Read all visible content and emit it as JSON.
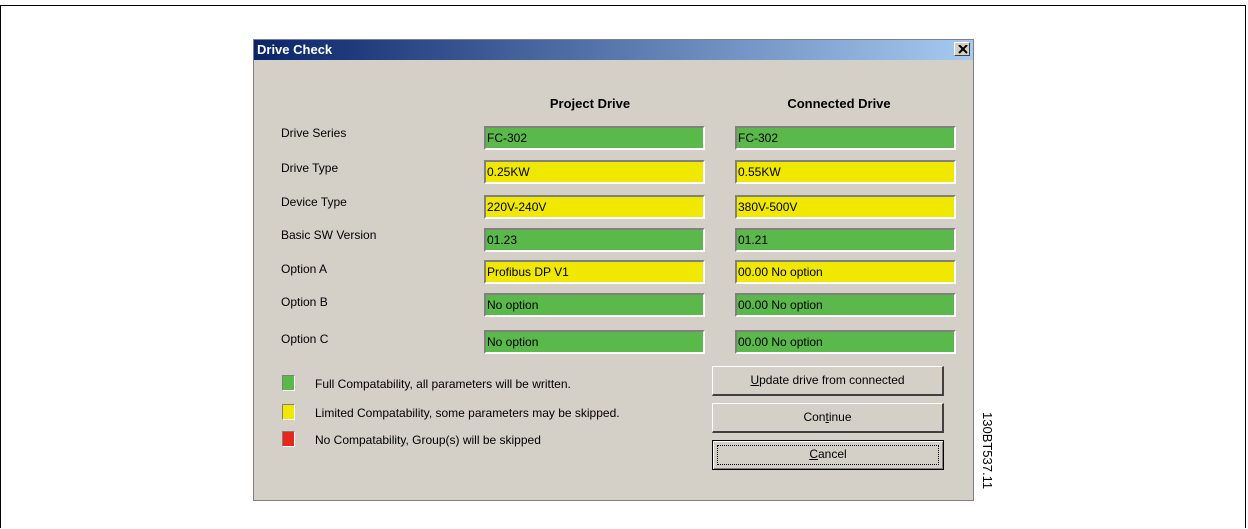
{
  "dialog": {
    "title": "Drive Check",
    "close_glyph": "✕"
  },
  "columns": {
    "project": "Project Drive",
    "connected": "Connected Drive"
  },
  "rows": [
    {
      "label": "Drive Series",
      "project": "FC-302",
      "connected": "FC-302",
      "project_status": "green",
      "connected_status": "green"
    },
    {
      "label": "Drive Type",
      "project": "0.25KW",
      "connected": "0.55KW",
      "project_status": "yellow",
      "connected_status": "yellow"
    },
    {
      "label": "Device Type",
      "project": "220V-240V",
      "connected": "380V-500V",
      "project_status": "yellow",
      "connected_status": "yellow"
    },
    {
      "label": "Basic SW Version",
      "project": "01.23",
      "connected": "01.21",
      "project_status": "green",
      "connected_status": "green"
    },
    {
      "label": "Option A",
      "project": "Profibus DP V1",
      "connected": "00.00 No option",
      "project_status": "yellow",
      "connected_status": "yellow"
    },
    {
      "label": "Option B",
      "project": "No option",
      "connected": "00.00 No option",
      "project_status": "green",
      "connected_status": "green"
    },
    {
      "label": "Option C",
      "project": "No option",
      "connected": "00.00 No option",
      "project_status": "green",
      "connected_status": "green"
    }
  ],
  "legend": [
    {
      "color": "#5ab94a",
      "text": "Full Compatability, all parameters will be written."
    },
    {
      "color": "#f0e800",
      "text": "Limited Compatability, some parameters may be skipped."
    },
    {
      "color": "#e8261c",
      "text": "No Compatability, Group(s) will be skipped"
    }
  ],
  "buttons": {
    "update": {
      "pre": "",
      "accel": "U",
      "post": "pdate drive from connected"
    },
    "continue": {
      "pre": "Con",
      "accel": "t",
      "post": "inue"
    },
    "cancel": {
      "pre": "",
      "accel": "C",
      "post": "ancel"
    }
  },
  "side_reference": "130BT537.11"
}
